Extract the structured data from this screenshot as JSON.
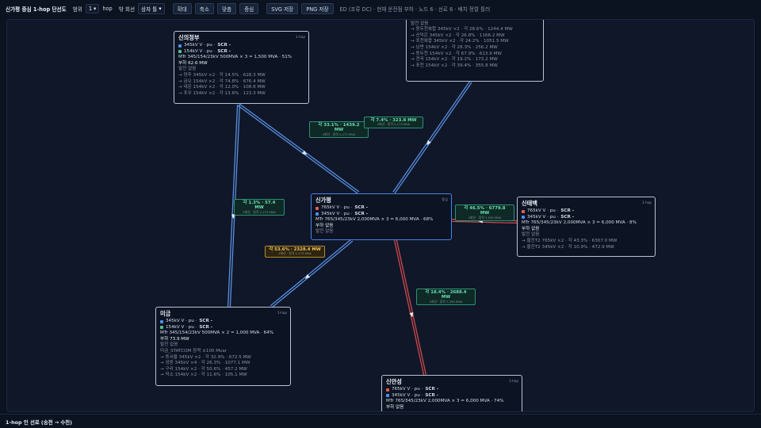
{
  "toolbar": {
    "title": "신가평 중심 1-hop 단선도",
    "range_label": "범위",
    "range_value": "1",
    "hop_label": "hop",
    "bus_label": "밖 회선",
    "mode_value": "상자 틀",
    "buttons": [
      "확대",
      "축소",
      "맞춤",
      "중심",
      "SVG 저장",
      "PNG 저장"
    ],
    "info": "ED (조류 DC) · 현재 운전점 부하 · 노드 6 · 선로 6 · 배치 정렬 틀러"
  },
  "colors": {
    "v765": "#e0605a",
    "v345": "#4f8fe8",
    "v154": "#4cc38a",
    "edge_blue": "#5a8fe0",
    "edge_red": "#d04a4a"
  },
  "nodes": [
    {
      "id": "sinuijeongbu",
      "name": "신의정부",
      "hop": "1-hop",
      "buses": [
        {
          "v": "345kV V · pu · ",
          "b": "SCR -",
          "c": "v345"
        },
        {
          "v": "154kV V · pu · ",
          "b": "SCR -",
          "c": "v154"
        }
      ],
      "mtr": "MTr 345/154/23kV 500MVA × 3 = 1,500 MVA · 51%",
      "load": "부하 62.6 MW",
      "gen": "발전 없음",
      "lines": [
        "→ 양주 345kV ×2 · 각 14.5% · 628.3 MW",
        "→ 금오 154kV ×2 · 각 74.8% · 676.4 MW",
        "→ 내운 154kV ×2 · 각 12.0% · 108.8 MW",
        "→ 포우 154kV ×2 · 각 13.6% · 123.3 MW"
      ]
    },
    {
      "id": "top",
      "name": "",
      "hop": "",
      "buses": [],
      "mtr": "부하 34.5 MW",
      "load": "발전 없음",
      "gen": "",
      "lines": [
        "→ 동두천복합 345kV ×2 · 각 28.6% · 1244.4 MW",
        "→ 신덕은 345kV ×2 · 각 26.8% · 1166.2 MW",
        "→ 포천복합 345kV ×2 · 각 24.2% · 1051.5 MW",
        "→ 남면 154kV ×2 · 각 28.3% · 256.2 MW",
        "→ 동두천 154kV ×2 · 각 67.9% · 613.9 MW",
        "→ 전곡 154kV ×2 · 각 19.2% · 173.2 MW",
        "→ 포천 154kV ×2 · 각 39.4% · 355.8 MW"
      ]
    },
    {
      "id": "singapyeong",
      "name": "신가평",
      "hop": "중심",
      "buses": [
        {
          "v": "765kV V · pu · ",
          "b": "SCR -",
          "c": "v765"
        },
        {
          "v": "345kV V · pu · ",
          "b": "SCR -",
          "c": "v345"
        }
      ],
      "mtr": "MTr 765/345/23kV 2,000MVA × 3 = 6,000 MVA · 68%",
      "load": "부하 없음",
      "gen": "발전 없음",
      "lines": []
    },
    {
      "id": "sintaebaek",
      "name": "신태백",
      "hop": "1-hop",
      "buses": [
        {
          "v": "765kV V · pu · ",
          "b": "SCR -",
          "c": "v765"
        },
        {
          "v": "345kV V · pu · ",
          "b": "SCR -",
          "c": "v345"
        }
      ],
      "mtr": "MTr 765/345/23kV 2,000MVA × 3 = 6,000 MVA · 8%",
      "load": "부하 없음",
      "gen": "발전 없음",
      "lines": [
        "→ 울진T2 765kV ×2 · 각 43.3% · 6307.0 MW",
        "→ 울진T2 345kV ×2 · 각 10.9% · 472.9 MW"
      ]
    },
    {
      "id": "migeum",
      "name": "미금",
      "hop": "1-hop",
      "buses": [
        {
          "v": "345kV V · pu · ",
          "b": "SCR -",
          "c": "v345"
        },
        {
          "v": "154kV V · pu · ",
          "b": "SCR -",
          "c": "v154"
        }
      ],
      "mtr": "MTr 345/154/23kV 500MVA × 2 = 1,000 MVA · 64%",
      "load": "부하 73.9 MW",
      "gen": "발전 없음",
      "extra": "미금_STATCOM 정격 ±100 Mvar",
      "lines": [
        "→ 동서울 345kV ×2 · 각 32.9% · 672.5 MW",
        "→ 성동 345kV ×4 · 각 26.3% · 1077.1 MW",
        "→ 구리 154kV ×2 · 각 50.6% · 457.2 MW",
        "→ 덕소 154kV ×2 · 각 11.6% · 105.1 MW"
      ]
    },
    {
      "id": "sinanseong",
      "name": "신안성",
      "hop": "1-hop",
      "buses": [
        {
          "v": "765kV V · pu · ",
          "b": "SCR -",
          "c": "v765"
        },
        {
          "v": "345kV V · pu · ",
          "b": "SCR -",
          "c": "v345"
        }
      ],
      "mtr": "MTr 765/345/23kV 2,000MVA × 3 = 6,000 MVA · 74%",
      "load": "부하 없음",
      "gen": "",
      "lines": []
    }
  ],
  "edges": [
    {
      "id": "e-sinuijeongbu-center",
      "v": "각 33.1% · 1439.2 MW",
      "s": "2회선 · 정격 2,173 MVA",
      "cls": "green",
      "color": "edge_blue"
    },
    {
      "id": "e-top-center",
      "v": "각 7.4% · 323.8 MW",
      "s": "2회선 · 정격 2,173 MVA",
      "cls": "green",
      "color": "edge_blue"
    },
    {
      "id": "e-sinuijeongbu-migeum",
      "v": "각 1.3% · 57.4 MW",
      "s": "2회선 · 정격 2,173 MVA",
      "cls": "green",
      "color": "edge_blue"
    },
    {
      "id": "e-sintaebaek-center",
      "v": "각 46.5% · 6779.8 MW",
      "s": "2회선 · 정격 7,290 MVA",
      "cls": "green",
      "color": "edge_red"
    },
    {
      "id": "e-migeum-center",
      "v": "각 53.6% · 2328.4 MW",
      "s": "2회선 · 정격 2,173 MVA",
      "cls": "yellow",
      "color": "edge_blue"
    },
    {
      "id": "e-sinanseong-center",
      "v": "각 18.4% · 2688.4 MW",
      "s": "2회선 · 정격 7,290 MVA",
      "cls": "green",
      "color": "edge_red"
    }
  ],
  "bottom": {
    "title": "1-hop 인 선로 (송전 → 수전)"
  }
}
